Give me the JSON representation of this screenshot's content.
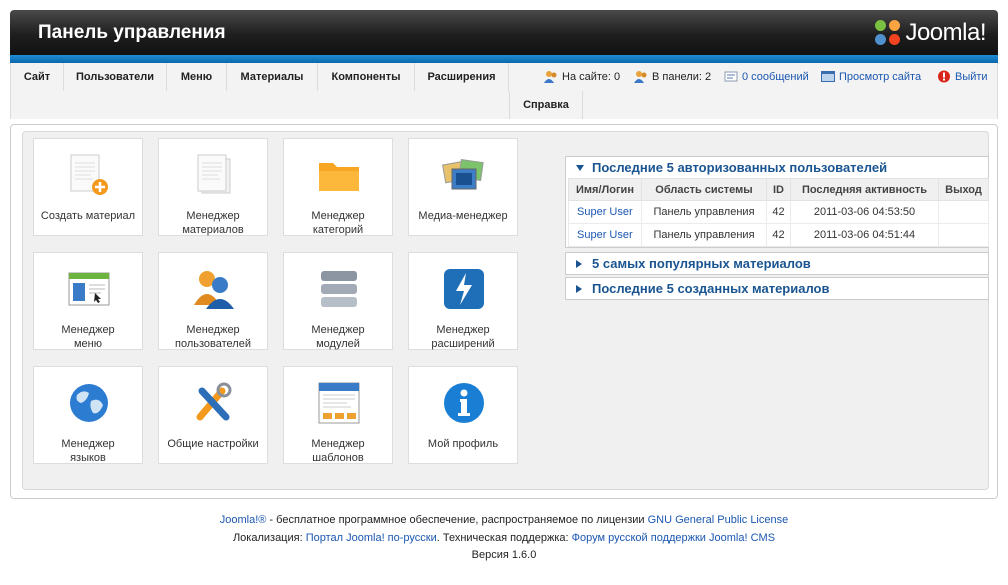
{
  "header": {
    "title": "Панель управления",
    "logo_text": "Joomla!"
  },
  "menu": {
    "items": [
      "Сайт",
      "Пользователи",
      "Меню",
      "Материалы",
      "Компоненты",
      "Расширения"
    ],
    "help": "Справка"
  },
  "status": {
    "on_site": "На сайте: 0",
    "in_panel": "В панели: 2",
    "messages": "0 сообщений",
    "preview": "Просмотр сайта",
    "logout": "Выйти"
  },
  "quickicons": [
    {
      "label": "Создать материал",
      "icon": "new-article-icon"
    },
    {
      "label": "Менеджер\nматериалов",
      "icon": "article-manager-icon"
    },
    {
      "label": "Менеджер\nкатегорий",
      "icon": "category-folder-icon"
    },
    {
      "label": "Медиа-менеджер",
      "icon": "media-manager-icon"
    },
    {
      "label": "Менеджер\nменю",
      "icon": "menu-manager-icon"
    },
    {
      "label": "Менеджер\nпользователей",
      "icon": "user-manager-icon"
    },
    {
      "label": "Менеджер\nмодулей",
      "icon": "module-manager-icon"
    },
    {
      "label": "Менеджер\nрасширений",
      "icon": "extension-manager-icon"
    },
    {
      "label": "Менеджер\nязыков",
      "icon": "language-globe-icon"
    },
    {
      "label": "Общие настройки",
      "icon": "settings-tools-icon"
    },
    {
      "label": "Менеджер\nшаблонов",
      "icon": "template-manager-icon"
    },
    {
      "label": "Мой профиль",
      "icon": "info-profile-icon"
    }
  ],
  "panels": {
    "logged_users": {
      "title": "Последние 5 авторизованных пользователей",
      "columns": [
        "Имя/Логин",
        "Область системы",
        "ID",
        "Последняя активность",
        "Выход"
      ],
      "rows": [
        [
          "Super User",
          "Панель управления",
          "42",
          "2011-03-06 04:53:50",
          ""
        ],
        [
          "Super User",
          "Панель управления",
          "42",
          "2011-03-06 04:51:44",
          ""
        ]
      ]
    },
    "popular": {
      "title": "5 самых популярных материалов"
    },
    "latest": {
      "title": "Последние 5 созданных материалов"
    }
  },
  "footer": {
    "line1_link1": "Joomla!®",
    "line1_text": " - бесплатное программное обеспечение, распространяемое по лицензии ",
    "line1_link2": "GNU General Public License",
    "line2_text1": "Локализация: ",
    "line2_link1": "Портал Joomla! по-русски",
    "line2_text2": ". Техническая поддержка: ",
    "line2_link2": "Форум русской поддержки Joomla! CMS",
    "version": "Версия 1.6.0"
  },
  "colors": {
    "accent": "#1b57b1",
    "header_dark": "#1e1e1e",
    "strip_blue": "#0b67a8"
  }
}
